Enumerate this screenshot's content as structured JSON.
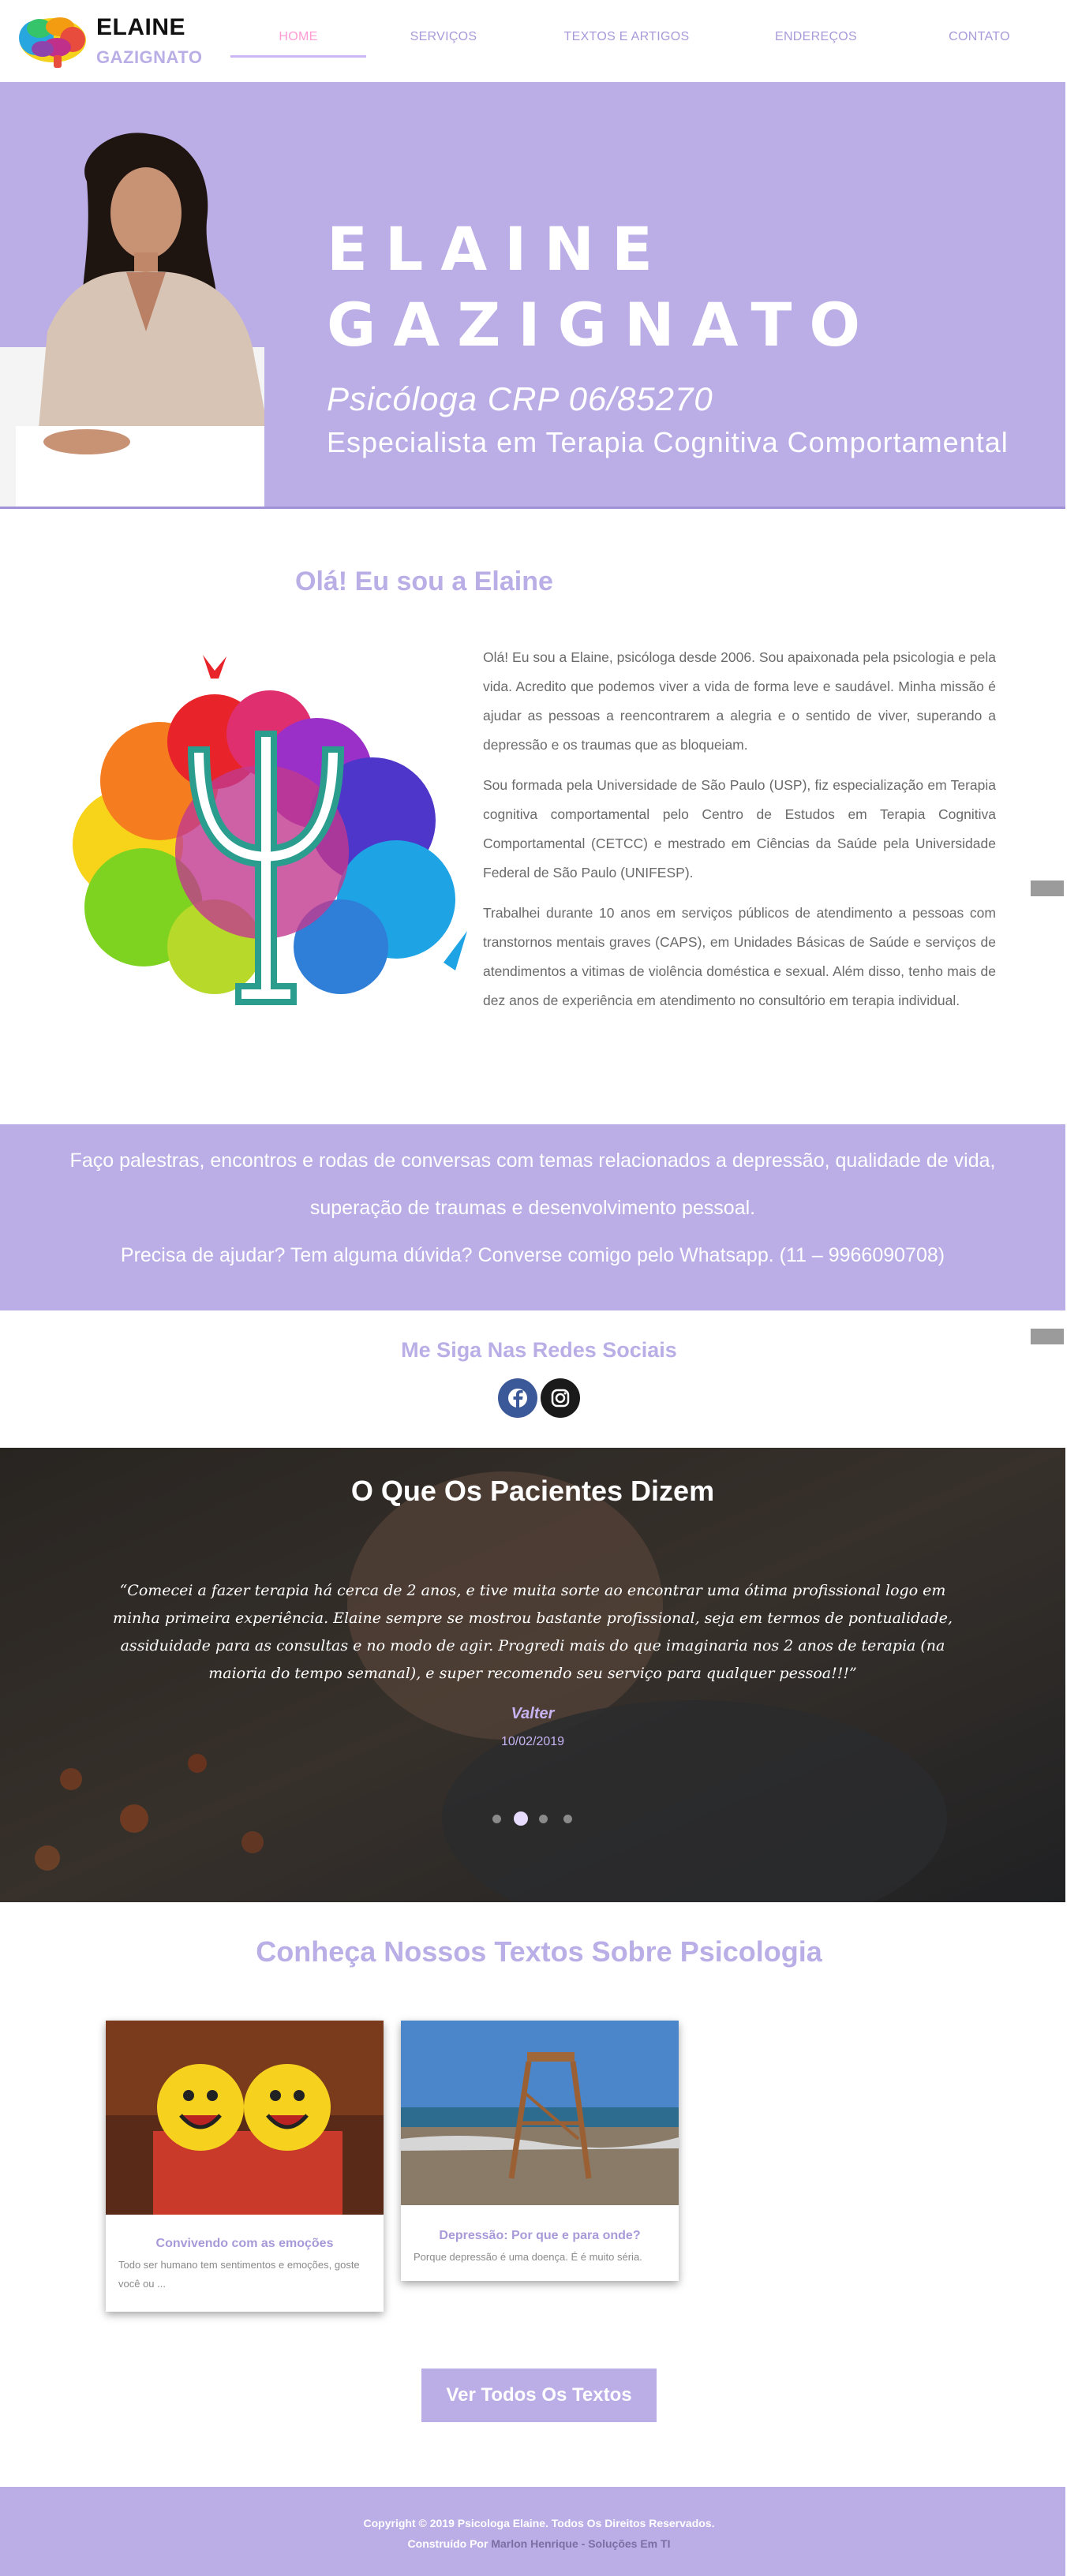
{
  "brand": {
    "line1": "ELAINE",
    "line2": "GAZIGNATO"
  },
  "nav": {
    "items": [
      {
        "label": "HOME",
        "active": true
      },
      {
        "label": "SERVIÇOS",
        "active": false
      },
      {
        "label": "TEXTOS E ARTIGOS",
        "active": false
      },
      {
        "label": "ENDEREÇOS",
        "active": false
      },
      {
        "label": "CONTATO",
        "active": false
      }
    ]
  },
  "hero": {
    "name": "ELAINE\nGAZIGNATO",
    "crp": "Psicóloga CRP 06/85270",
    "specialty": "Especialista em Terapia Cognitiva Comportamental"
  },
  "about": {
    "title": "Olá! Eu sou a Elaine",
    "paragraphs": [
      "Olá! Eu sou a Elaine, psicóloga desde 2006. Sou apaixonada pela psicologia e pela vida. Acredito que podemos viver a vida de forma leve e saudável. Minha missão é ajudar as pessoas a reencontrarem a alegria e o sentido de viver, superando a depressão e os traumas que as bloqueiam.",
      "Sou formada pela Universidade de São Paulo (USP), fiz especialização em Terapia cognitiva comportamental pelo Centro de Estudos em Terapia Cognitiva Comportamental (CETCC) e mestrado em Ciências da Saúde pela Universidade Federal de São Paulo (UNIFESP).",
      "Trabalhei durante 10 anos em serviços públicos de atendimento a pessoas com transtornos mentais graves (CAPS), em Unidades Básicas de Saúde e serviços de atendimentos a vitimas de violência doméstica e sexual.  Além disso, tenho mais de dez anos de experiência em atendimento no consultório em terapia individual."
    ]
  },
  "band": {
    "line1": "Faço palestras, encontros e rodas de conversas com temas relacionados a depressão, qualidade de vida, superação de traumas e desenvolvimento pessoal.",
    "line2": "Precisa de ajudar? Tem alguma dúvida? Converse comigo pelo Whatsapp. (11 – 9966090708)"
  },
  "social": {
    "title": "Me Siga Nas Redes Sociais",
    "icons": [
      "facebook-icon",
      "instagram-icon"
    ],
    "colors": {
      "facebook": "#3b5998",
      "instagram": "#1a1a1a"
    }
  },
  "testimonials": {
    "title": "O Que Os Pacientes Dizem",
    "quote": "“Comecei a fazer terapia há cerca de 2 anos, e tive muita sorte ao encontrar uma ótima profissional logo em minha primeira experiência. Elaine sempre se mostrou bastante profissional, seja em termos de pontualidade, assiduidade para as consultas e no modo de agir. Progredi mais do que imaginaria nos 2 anos de terapia (na maioria do tempo semanal), e super recomendo seu serviço para qualquer pessoa!!!”",
    "author": "Valter",
    "date": "10/02/2019",
    "dots": 4,
    "active_dot": 1
  },
  "texts": {
    "title": "Conheça Nossos Textos Sobre Psicologia",
    "cards": [
      {
        "title": "Convivendo com as emoções",
        "excerpt": "Todo ser humano tem sentimentos e emoções, goste você ou ..."
      },
      {
        "title": "Depressão: Por que e para onde?",
        "excerpt": "Porque depressão é uma doença. É é muito séria."
      }
    ],
    "button": "Ver Todos Os Textos"
  },
  "footer": {
    "copyright": "Copyright © 2019 Psicologa Elaine. Todos Os Direitos Reservados.",
    "built_prefix": "Construído Por",
    "builder": "Marlon Henrique - Soluções Em TI"
  },
  "colors": {
    "accent": "#bbade6",
    "nav": "#a89ad9",
    "nav_active": "#ff9cd3"
  }
}
